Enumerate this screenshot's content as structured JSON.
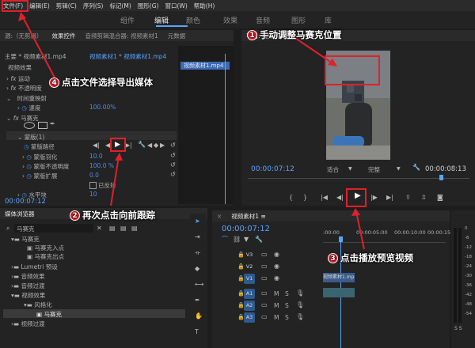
{
  "menu": [
    "文件(F)",
    "编辑(E)",
    "剪辑(C)",
    "序列(S)",
    "标记(M)",
    "图形(G)",
    "窗口(W)",
    "帮助(H)"
  ],
  "workspaces": [
    "组件",
    "编辑",
    "颜色",
    "效果",
    "音频",
    "图形",
    "库"
  ],
  "left_tabs": [
    "源:（无剪辑）",
    "效果控件",
    "音频剪辑混合器: 视频素材1",
    "元数据"
  ],
  "ec": {
    "clip_label": "主要 * 视频素材1.mp4",
    "seq_label": "视频素材1 * 视频素材1.mp4",
    "video_effects": "视频效果",
    "motion": "运动",
    "opacity": "不透明度",
    "time_remap": "时间重映射",
    "speed": "速度",
    "speed_value": "100.00%",
    "mosaic": "马赛克",
    "mask": "蒙版(1)",
    "mask_path": "蒙版路径",
    "mask_feather": "蒙版羽化",
    "mask_feather_value": "10.0",
    "mask_opacity": "蒙版不透明度",
    "mask_opacity_value": "100.0 %",
    "mask_expand": "蒙版扩展",
    "mask_expand_value": "0.0",
    "inverted": "已反转",
    "h_blocks": "水平块",
    "h_blocks_value": "10",
    "clip_bar": "视频素材1.mp4",
    "timecode": "00:00:07:12"
  },
  "program": {
    "title": "节目: 视频素材1 ≡",
    "timecode": "00:00:07:12",
    "fit": "适合",
    "quality": "完整",
    "duration": "00:00:08:13"
  },
  "media": {
    "tab": "媒体浏览器",
    "search_value": "马赛克",
    "tree": [
      "马赛克",
      "马赛克入点",
      "马赛克出点",
      "Lumetri 预设",
      "音频效果",
      "音频过渡",
      "视频效果",
      "风格化",
      "马赛克",
      "视频过渡"
    ]
  },
  "timeline": {
    "tab": "视频素材1 ≡",
    "timecode": "00:00:07:12",
    "ruler": [
      ":00:00",
      "00:00:05:00",
      "00:00:10:00",
      "00:00:15:00"
    ],
    "tracks": [
      "V3",
      "V2",
      "V1",
      "A1",
      "A2",
      "A3"
    ],
    "clip_video": "视频素材1.mp4 [V]"
  },
  "meter": {
    "labels": [
      "0",
      "-6",
      "-12",
      "-18",
      "-24",
      "-30",
      "-36",
      "-42",
      "-48",
      "-54"
    ],
    "bottom": "S  S"
  },
  "annotations": {
    "c1": "手动调整马赛克位置",
    "c2": "再次点击向前跟踪",
    "c3": "点击播放预览视频",
    "c4": "点击文件选择导出媒体",
    "n1": "1",
    "n2": "2",
    "n3": "3",
    "n4": "4"
  },
  "colors": {
    "accent": "#4a8fe0",
    "annotation": "#e0202a"
  }
}
